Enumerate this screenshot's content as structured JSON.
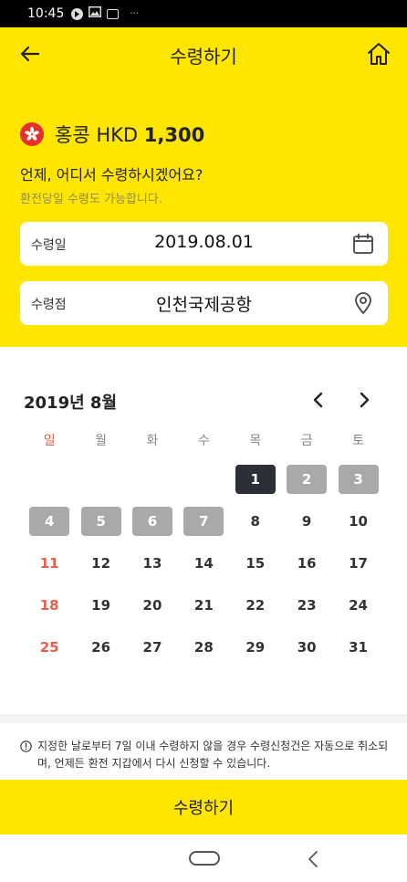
{
  "status_bar": {
    "time": "10:45",
    "more": "···"
  },
  "header": {
    "title": "수령하기",
    "back_icon": "arrow-left-icon",
    "home_icon": "home-icon"
  },
  "currency": {
    "flag": "hong-kong-flag-icon",
    "name": "홍콩 HKD",
    "amount": "1,300"
  },
  "question": "언제, 어디서 수령하시겠어요?",
  "subnote": "환전당일 수령도 가능합니다.",
  "fields": {
    "date": {
      "label": "수령일",
      "value": "2019.08.01",
      "icon": "calendar-icon"
    },
    "place": {
      "label": "수령점",
      "value": "인천국제공항",
      "icon": "location-pin-icon"
    }
  },
  "calendar": {
    "month_title": "2019년 8월",
    "weekdays": [
      "일",
      "월",
      "화",
      "수",
      "목",
      "금",
      "토"
    ],
    "selected": 1,
    "unavailable": [
      2,
      3,
      4,
      5,
      6,
      7
    ],
    "weeks": [
      [
        null,
        null,
        null,
        null,
        1,
        2,
        3
      ],
      [
        4,
        5,
        6,
        7,
        8,
        9,
        10
      ],
      [
        11,
        12,
        13,
        14,
        15,
        16,
        17
      ],
      [
        18,
        19,
        20,
        21,
        22,
        23,
        24
      ],
      [
        25,
        26,
        27,
        28,
        29,
        30,
        31
      ]
    ]
  },
  "notice": "지정한 날로부터 7일 이내 수령하지 않을 경우 수령신청건은 자동으로 취소되며, 언제든 환전 지갑에서 다시 신청할 수 있습니다.",
  "submit_label": "수령하기",
  "colors": {
    "accent": "#ffe600",
    "selected": "#2c2e38",
    "unavailable": "#a9a9a9",
    "sunday": "#e8604c"
  }
}
